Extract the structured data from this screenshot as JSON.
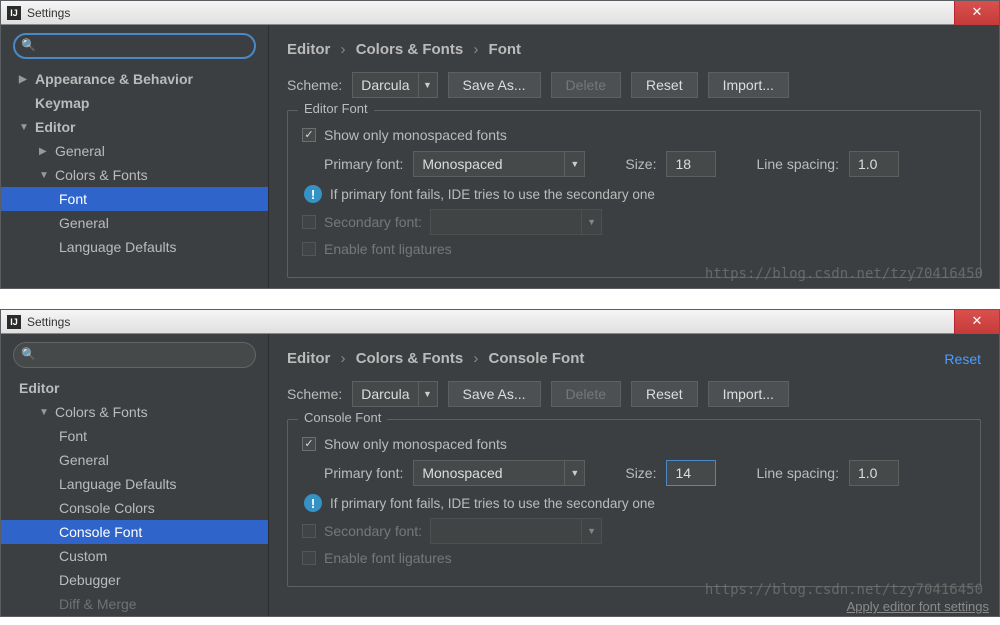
{
  "panel1": {
    "title": "Settings",
    "search_value": "",
    "tree": {
      "appearance": "Appearance & Behavior",
      "keymap": "Keymap",
      "editor": "Editor",
      "general": "General",
      "colors_fonts": "Colors & Fonts",
      "font": "Font",
      "general2": "General",
      "language_defaults": "Language Defaults"
    },
    "breadcrumb": {
      "a": "Editor",
      "b": "Colors & Fonts",
      "c": "Font"
    },
    "scheme_label": "Scheme:",
    "scheme_value": "Darcula",
    "btn_save_as": "Save As...",
    "btn_delete": "Delete",
    "btn_reset": "Reset",
    "btn_import": "Import...",
    "fieldset_title": "Editor Font",
    "show_monospaced": "Show only monospaced fonts",
    "primary_font_label": "Primary font:",
    "primary_font_value": "Monospaced",
    "size_label": "Size:",
    "size_value": "18",
    "line_spacing_label": "Line spacing:",
    "line_spacing_value": "1.0",
    "info_text": "If primary font fails, IDE tries to use the secondary one",
    "secondary_font_label": "Secondary font:",
    "secondary_font_value": "",
    "ligatures": "Enable font ligatures",
    "watermark": "https://blog.csdn.net/tzy70416450"
  },
  "panel2": {
    "title": "Settings",
    "search_value": "",
    "tree": {
      "editor": "Editor",
      "colors_fonts": "Colors & Fonts",
      "font": "Font",
      "general": "General",
      "language_defaults": "Language Defaults",
      "console_colors": "Console Colors",
      "console_font": "Console Font",
      "custom": "Custom",
      "debugger": "Debugger",
      "diff_merge": "Diff & Merge"
    },
    "breadcrumb": {
      "a": "Editor",
      "b": "Colors & Fonts",
      "c": "Console Font"
    },
    "reset_link": "Reset",
    "scheme_label": "Scheme:",
    "scheme_value": "Darcula",
    "btn_save_as": "Save As...",
    "btn_delete": "Delete",
    "btn_reset": "Reset",
    "btn_import": "Import...",
    "fieldset_title": "Console Font",
    "show_monospaced": "Show only monospaced fonts",
    "primary_font_label": "Primary font:",
    "primary_font_value": "Monospaced",
    "size_label": "Size:",
    "size_value": "14",
    "line_spacing_label": "Line spacing:",
    "line_spacing_value": "1.0",
    "info_text": "If primary font fails, IDE tries to use the secondary one",
    "secondary_font_label": "Secondary font:",
    "secondary_font_value": "",
    "ligatures": "Enable font ligatures",
    "watermark": "https://blog.csdn.net/tzy70416450",
    "apply_editor": "Apply editor font settings"
  }
}
